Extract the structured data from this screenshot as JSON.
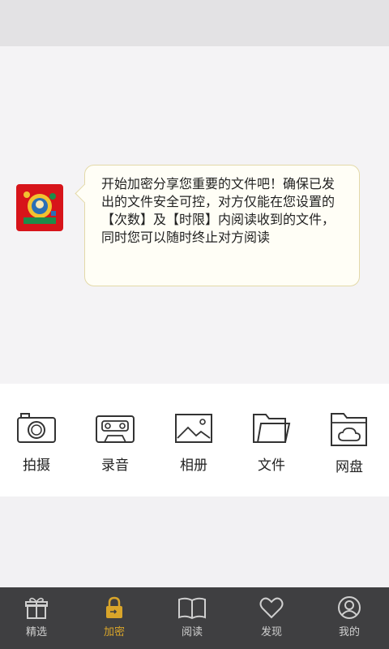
{
  "chat": {
    "message": "开始加密分享您重要的文件吧！确保已发出的文件安全可控，对方仅能在您设置的【次数】及【时限】内阅读收到的文件，同时您可以随时终止对方阅读"
  },
  "tools": [
    {
      "label": "拍摄",
      "icon": "camera-icon"
    },
    {
      "label": "录音",
      "icon": "cassette-icon"
    },
    {
      "label": "相册",
      "icon": "image-icon"
    },
    {
      "label": "文件",
      "icon": "folder-icon"
    },
    {
      "label": "网盘",
      "icon": "cloud-folder-icon"
    }
  ],
  "tabbar": {
    "active_color": "#d9a52a",
    "items": [
      {
        "label": "精选",
        "icon": "gift-icon"
      },
      {
        "label": "加密",
        "icon": "lock-icon",
        "active": true
      },
      {
        "label": "阅读",
        "icon": "book-icon"
      },
      {
        "label": "发现",
        "icon": "heart-icon"
      },
      {
        "label": "我的",
        "icon": "user-icon"
      }
    ]
  }
}
